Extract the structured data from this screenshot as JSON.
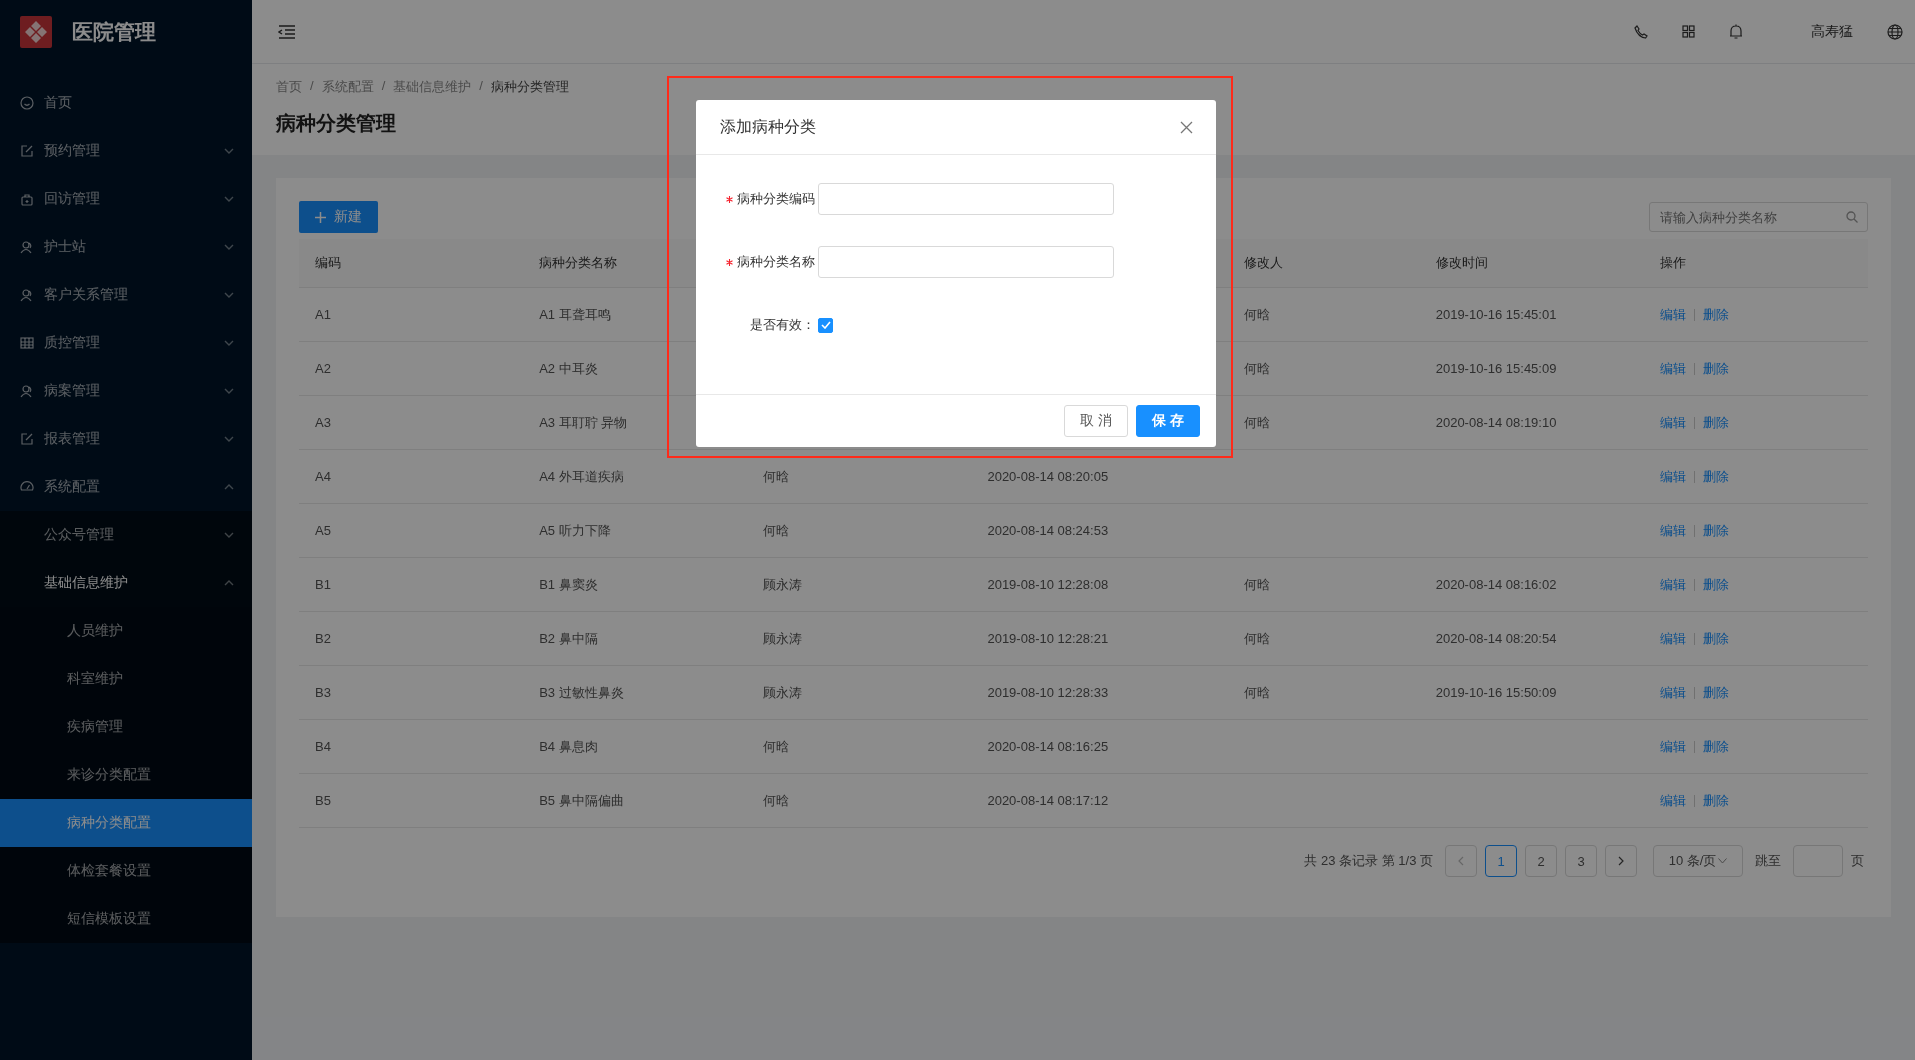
{
  "app": {
    "title": "医院管理"
  },
  "sidebar": {
    "items": [
      {
        "label": "首页"
      },
      {
        "label": "预约管理",
        "expanded": false
      },
      {
        "label": "回访管理",
        "expanded": false
      },
      {
        "label": "护士站",
        "expanded": false
      },
      {
        "label": "客户关系管理",
        "expanded": false
      },
      {
        "label": "质控管理",
        "expanded": false
      },
      {
        "label": "病案管理",
        "expanded": false
      },
      {
        "label": "报表管理",
        "expanded": false
      },
      {
        "label": "系统配置",
        "expanded": true,
        "children": [
          {
            "label": "公众号管理",
            "expanded": false
          },
          {
            "label": "基础信息维护",
            "expanded": true,
            "children": [
              {
                "label": "人员维护",
                "selected": false
              },
              {
                "label": "科室维护",
                "selected": false
              },
              {
                "label": "疾病管理",
                "selected": false
              },
              {
                "label": "来诊分类配置",
                "selected": false
              },
              {
                "label": "病种分类配置",
                "selected": true
              },
              {
                "label": "体检套餐设置",
                "selected": false
              },
              {
                "label": "短信模板设置",
                "selected": false
              }
            ]
          }
        ]
      }
    ]
  },
  "header": {
    "user": "高寿猛"
  },
  "breadcrumb": [
    "首页",
    "系统配置",
    "基础信息维护",
    "病种分类管理"
  ],
  "breadcrumb_separator": "/",
  "page_title": "病种分类管理",
  "toolbar": {
    "new_button": "新建",
    "search": {
      "placeholder": "请输入病种分类名称"
    }
  },
  "table": {
    "columns": [
      {
        "label": "编码"
      },
      {
        "label": "病种分类名称"
      },
      {},
      {},
      {
        "label": "修改人"
      },
      {
        "label": "修改时间"
      },
      {
        "label": "操作"
      }
    ],
    "rows": [
      {
        "code": "A1",
        "name": "A1 耳聋耳鸣",
        "modifier": "何晗",
        "modified": "2019-10-16 15:45:01",
        "actions": [
          "编辑",
          "删除"
        ]
      },
      {
        "code": "A2",
        "name": "A2 中耳炎",
        "modifier": "何晗",
        "modified": "2019-10-16 15:45:09",
        "actions": [
          "编辑",
          "删除"
        ]
      },
      {
        "code": "A3",
        "name": "A3 耳耵聍 异物",
        "modifier": "何晗",
        "modified": "2020-08-14 08:19:10",
        "actions": [
          "编辑",
          "删除"
        ]
      },
      {
        "code": "A4",
        "name": "A4 外耳道疾病",
        "creator": "何晗",
        "created": "2020-08-14 08:20:05",
        "actions": [
          "编辑",
          "删除"
        ]
      },
      {
        "code": "A5",
        "name": "A5 听力下降",
        "creator": "何晗",
        "created": "2020-08-14 08:24:53",
        "actions": [
          "编辑",
          "删除"
        ]
      },
      {
        "code": "B1",
        "name": "B1 鼻窦炎",
        "creator": "顾永涛",
        "created": "2019-08-10 12:28:08",
        "modifier": "何晗",
        "modified": "2020-08-14 08:16:02",
        "actions": [
          "编辑",
          "删除"
        ]
      },
      {
        "code": "B2",
        "name": "B2 鼻中隔",
        "creator": "顾永涛",
        "created": "2019-08-10 12:28:21",
        "modifier": "何晗",
        "modified": "2020-08-14 08:20:54",
        "actions": [
          "编辑",
          "删除"
        ]
      },
      {
        "code": "B3",
        "name": "B3 过敏性鼻炎",
        "creator": "顾永涛",
        "created": "2019-08-10 12:28:33",
        "modifier": "何晗",
        "modified": "2019-10-16 15:50:09",
        "actions": [
          "编辑",
          "删除"
        ]
      },
      {
        "code": "B4",
        "name": "B4 鼻息肉",
        "creator": "何晗",
        "created": "2020-08-14 08:16:25",
        "actions": [
          "编辑",
          "删除"
        ]
      },
      {
        "code": "B5",
        "name": "B5 鼻中隔偏曲",
        "creator": "何晗",
        "created": "2020-08-14 08:17:12",
        "actions": [
          "编辑",
          "删除"
        ]
      }
    ]
  },
  "pagination": {
    "summary": "共 23 条记录 第 1/3 页",
    "pages": [
      {
        "label": "1",
        "selected": true
      },
      {
        "label": "2",
        "selected": false
      },
      {
        "label": "3",
        "selected": false
      }
    ],
    "page_size": "10 条/页",
    "jump_label": "跳至",
    "jump_suffix": "页"
  },
  "dialog": {
    "title": "添加病种分类",
    "highlighted": true,
    "fields": [
      {
        "kind": "text",
        "label": "病种分类编码",
        "required": true
      },
      {
        "kind": "text",
        "label": "病种分类名称",
        "required": true
      },
      {
        "kind": "checkbox",
        "label": "是否有效：",
        "checked": true
      }
    ],
    "buttons": [
      {
        "label": "取 消",
        "primary": false
      },
      {
        "label": "保 存",
        "primary": true
      }
    ]
  }
}
